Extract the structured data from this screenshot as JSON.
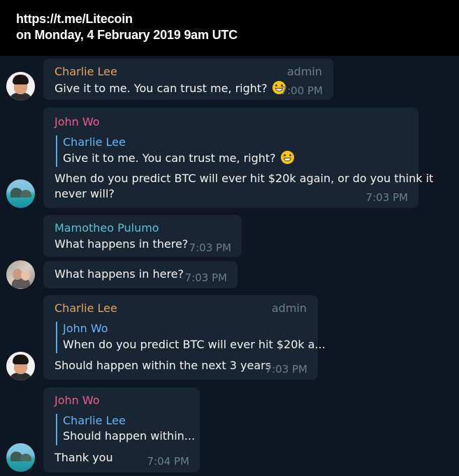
{
  "header": {
    "line1": "https://t.me/Litecoin",
    "line2": "on Monday, 4 February 2019 9am UTC"
  },
  "colors": {
    "background": "#0e1621",
    "bubble": "#182533",
    "charlie_name": "#e9a262",
    "john_name": "#e85e8f",
    "mamotheo_name": "#55c4d1",
    "reply_name": "#6ab3f3",
    "timestamp": "#6d7f8f"
  },
  "messages": [
    {
      "sender": "Charlie Lee",
      "badge": "admin",
      "text": "Give it to me. You can trust me, right?",
      "emoji": "grinning-face",
      "time": "7:00 PM"
    },
    {
      "sender": "John Wo",
      "reply_to": {
        "name": "Charlie Lee",
        "text": "Give it to me. You can trust me, right?",
        "emoji": "grinning-face"
      },
      "text_line1": "When do you predict BTC will ever hit $20k again, or do you think it",
      "text_line2": "never will?",
      "time": "7:03 PM"
    },
    {
      "sender": "Mamotheo Pulumo",
      "text": "What happens in there?",
      "time": "7:03 PM"
    },
    {
      "text": "What happens in here?",
      "time": "7:03 PM"
    },
    {
      "sender": "Charlie Lee",
      "badge": "admin",
      "reply_to": {
        "name": "John Wo",
        "text": "When do you predict BTC will ever hit $20k a..."
      },
      "text": "Should happen within the next 3 years",
      "time": "7:03 PM"
    },
    {
      "sender": "John Wo",
      "reply_to": {
        "name": "Charlie Lee",
        "text": "Should happen within..."
      },
      "text": "Thank you",
      "time": "7:04 PM"
    }
  ]
}
